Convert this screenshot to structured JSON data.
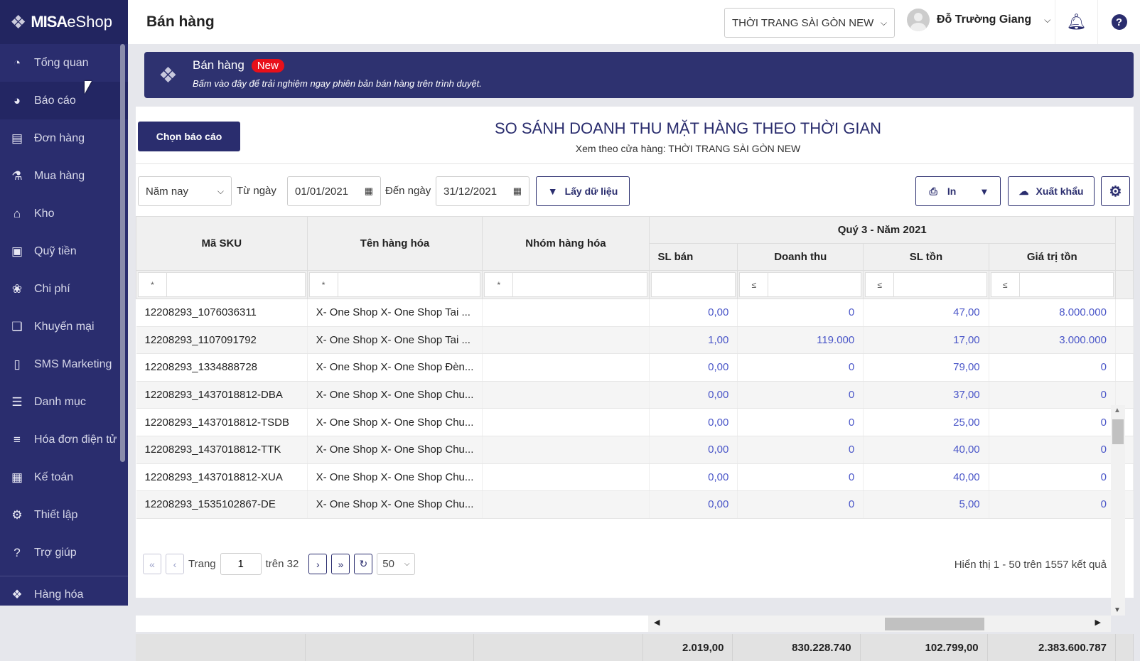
{
  "brand": {
    "logo_text_bold": "MISA",
    "logo_text": "eShop"
  },
  "sidebar": {
    "items": [
      {
        "label": "Tổng quan",
        "icon": "dashboard-icon"
      },
      {
        "label": "Báo cáo",
        "icon": "pie-chart-icon"
      },
      {
        "label": "Đơn hàng",
        "icon": "order-icon"
      },
      {
        "label": "Mua hàng",
        "icon": "cart-icon"
      },
      {
        "label": "Kho",
        "icon": "warehouse-icon"
      },
      {
        "label": "Quỹ tiền",
        "icon": "safe-icon"
      },
      {
        "label": "Chi phí",
        "icon": "money-bag-icon"
      },
      {
        "label": "Khuyến mại",
        "icon": "gift-icon"
      },
      {
        "label": "SMS Marketing",
        "icon": "phone-icon"
      },
      {
        "label": "Danh mục",
        "icon": "list-icon"
      },
      {
        "label": "Hóa đơn điện tử",
        "icon": "invoice-icon"
      },
      {
        "label": "Kế toán",
        "icon": "calculator-icon"
      },
      {
        "label": "Thiết lập",
        "icon": "gear-icon"
      },
      {
        "label": "Trợ giúp",
        "icon": "help-icon"
      },
      {
        "label": "Hàng hóa",
        "icon": "boxes-icon"
      }
    ]
  },
  "header": {
    "title": "Bán hàng",
    "store": "THỜI TRANG SÀI GÒN NEW",
    "user": "Đỗ Trường Giang"
  },
  "banner": {
    "title": "Bán hàng",
    "badge": "New",
    "subtitle": "Bấm vào đây để trải nghiệm ngay phiên bản bán hàng trên trình duyệt."
  },
  "report": {
    "choose_button": "Chọn báo cáo",
    "title": "SO SÁNH DOANH THU MẶT HÀNG THEO THỜI GIAN",
    "subtitle": "Xem theo cửa hàng: THỜI TRANG SÀI GÒN NEW"
  },
  "filters": {
    "period": "Năm nay",
    "from_label": "Từ ngày",
    "from": "01/01/2021",
    "to_label": "Đến ngày",
    "to": "31/12/2021",
    "fetch_button": "Lấy dữ liệu",
    "print_button": "In",
    "export_button": "Xuất khẩu"
  },
  "table": {
    "columns": {
      "sku": "Mã SKU",
      "name": "Tên hàng hóa",
      "group": "Nhóm hàng hóa",
      "period": "Quý 3 - Năm 2021",
      "qty": "SL bán",
      "revenue": "Doanh thu",
      "stock": "SL tồn",
      "stock_value": "Giá trị tồn"
    },
    "filter_ops": {
      "text": "*",
      "num": "≤"
    },
    "rows": [
      [
        "12208293_1076036311",
        "X- One Shop X- One Shop Tai ...",
        "",
        "0,00",
        "0",
        "47,00",
        "8.000.000"
      ],
      [
        "12208293_1107091792",
        "X- One Shop X- One Shop Tai ...",
        "",
        "1,00",
        "119.000",
        "17,00",
        "3.000.000"
      ],
      [
        "12208293_1334888728",
        "X- One Shop X- One Shop Đèn...",
        "",
        "0,00",
        "0",
        "79,00",
        "0"
      ],
      [
        "12208293_1437018812-DBA",
        "X- One Shop X- One Shop Chu...",
        "",
        "0,00",
        "0",
        "37,00",
        "0"
      ],
      [
        "12208293_1437018812-TSDB",
        "X- One Shop X- One Shop Chu...",
        "",
        "0,00",
        "0",
        "25,00",
        "0"
      ],
      [
        "12208293_1437018812-TTK",
        "X- One Shop X- One Shop Chu...",
        "",
        "0,00",
        "0",
        "40,00",
        "0"
      ],
      [
        "12208293_1437018812-XUA",
        "X- One Shop X- One Shop Chu...",
        "",
        "0,00",
        "0",
        "40,00",
        "0"
      ],
      [
        "12208293_1535102867-DE",
        "X- One Shop X- One Shop Chu...",
        "",
        "0,00",
        "0",
        "5,00",
        "0"
      ]
    ],
    "totals": {
      "qty": "2.019,00",
      "revenue": "830.228.740",
      "stock": "102.799,00",
      "stock_value": "2.383.600.787"
    }
  },
  "pager": {
    "page_label": "Trang",
    "page": "1",
    "of_label": "trên 32",
    "page_size": "50",
    "info": "Hiển thị 1 - 50 trên 1557 kết quả"
  }
}
